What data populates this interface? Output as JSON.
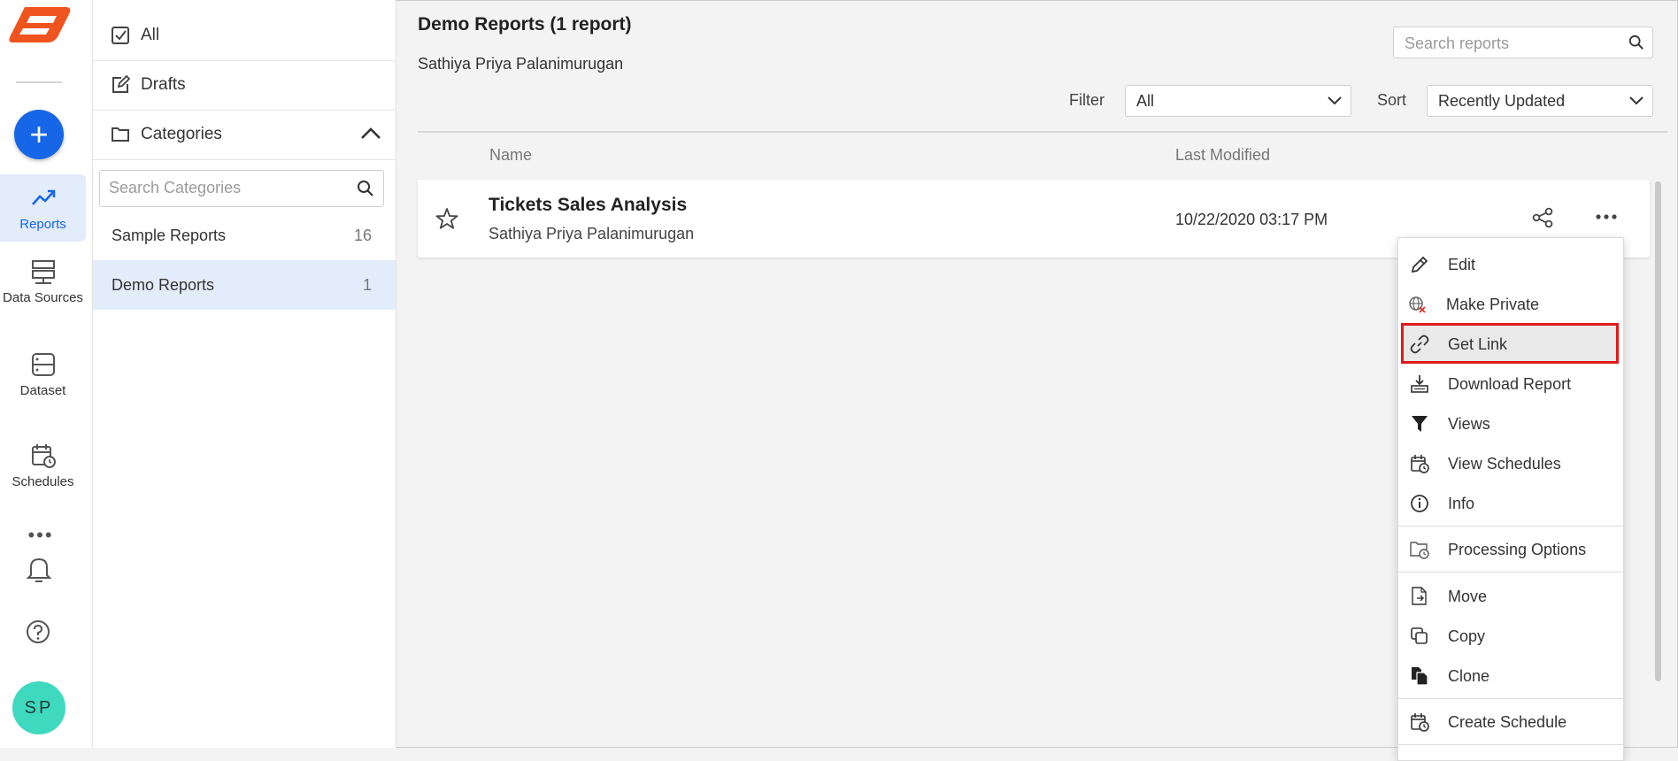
{
  "rail": {
    "items": [
      {
        "label": "Reports"
      },
      {
        "label": "Data Sources"
      },
      {
        "label": "Dataset"
      },
      {
        "label": "Schedules"
      }
    ],
    "avatar": "SP",
    "add_symbol": "+",
    "more_symbol": "•••"
  },
  "categories": {
    "all_label": "All",
    "drafts_label": "Drafts",
    "header_label": "Categories",
    "search_placeholder": "Search Categories",
    "items": [
      {
        "label": "Sample Reports",
        "count": "16"
      },
      {
        "label": "Demo Reports",
        "count": "1"
      }
    ]
  },
  "main": {
    "title": "Demo Reports (1 report)",
    "subtitle": "Sathiya Priya Palanimurugan",
    "search_placeholder": "Search reports",
    "filter_label": "Filter",
    "filter_value": "All",
    "sort_label": "Sort",
    "sort_value": "Recently Updated",
    "col_name": "Name",
    "col_modified": "Last Modified",
    "report": {
      "name": "Tickets Sales Analysis",
      "author": "Sathiya Priya Palanimurugan",
      "modified": "10/22/2020 03:17 PM"
    }
  },
  "menu": {
    "items": [
      {
        "label": "Edit",
        "icon": "pencil-icon"
      },
      {
        "label": "Make Private",
        "icon": "globe-lock-icon"
      },
      {
        "label": "Get Link",
        "icon": "link-icon"
      },
      {
        "label": "Download Report",
        "icon": "download-icon"
      },
      {
        "label": "Views",
        "icon": "filter-icon"
      },
      {
        "label": "View Schedules",
        "icon": "calendar-clock-icon"
      },
      {
        "label": "Info",
        "icon": "info-icon"
      },
      {
        "label": "Processing Options",
        "icon": "folder-clock-icon"
      },
      {
        "label": "Move",
        "icon": "move-file-icon"
      },
      {
        "label": "Copy",
        "icon": "copy-icon"
      },
      {
        "label": "Clone",
        "icon": "clone-icon"
      },
      {
        "label": "Create Schedule",
        "icon": "calendar-clock-icon"
      }
    ],
    "highlighted_item": "Get Link"
  },
  "colors": {
    "accent": "#1766e8",
    "logo": "#f0541e",
    "avatar_bg": "#3ed9bf",
    "highlight_border": "#e01919",
    "selected_bg": "#e3ecfb"
  }
}
